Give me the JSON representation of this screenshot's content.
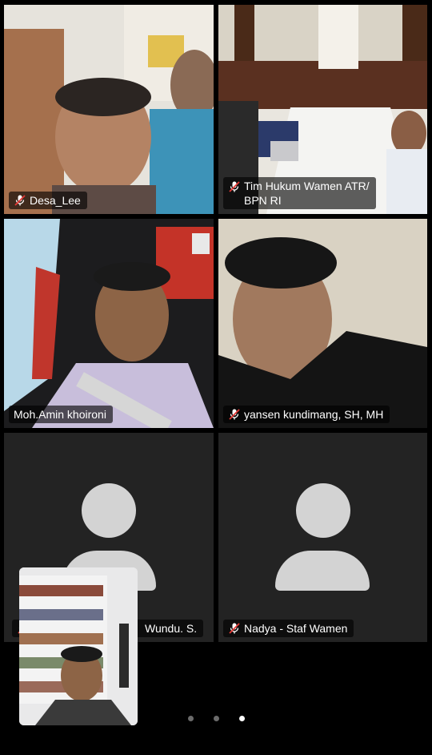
{
  "participants": [
    {
      "name": "Desa_Lee",
      "muted": true
    },
    {
      "name": "Tim Hukum Wamen ATR/",
      "name_line2": "BPN RI",
      "muted": true
    },
    {
      "name": "Moh.Amin khoironi",
      "muted": false,
      "speaking": true
    },
    {
      "name": "yansen kundimang, SH, MH",
      "muted": true
    },
    {
      "name": "Wundu. S.",
      "muted": true
    },
    {
      "name": "Nadya - Staf Wamen",
      "muted": true
    }
  ],
  "pager": {
    "total": 3,
    "current": 3
  },
  "colors": {
    "active_speaker_border": "#3cc14a",
    "tile_background": "#232323",
    "avatar": "#d3d3d3"
  }
}
